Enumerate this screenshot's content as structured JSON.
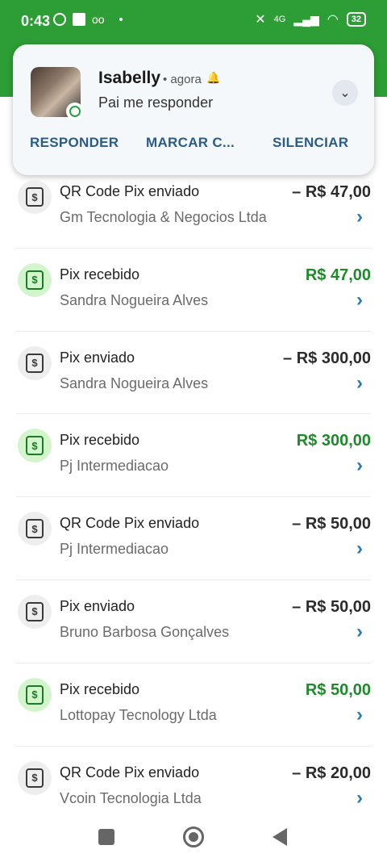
{
  "status_bar": {
    "time": "0:43",
    "network": "4G",
    "battery": "32"
  },
  "notification": {
    "sender": "Isabelly",
    "time": "• agora",
    "message": "Pai me responder",
    "actions": [
      "RESPONDER",
      "MARCAR C...",
      "SILENCIAR"
    ],
    "app_icon": "whatsapp-icon"
  },
  "transactions": [
    {
      "type": "QR Code Pix enviado",
      "name": "Gm Tecnologia & Negocios Ltda",
      "amount": "– R$ 47,00",
      "direction": "out"
    },
    {
      "type": "Pix recebido",
      "name": "Sandra Nogueira Alves",
      "amount": "R$ 47,00",
      "direction": "in"
    },
    {
      "type": "Pix enviado",
      "name": "Sandra Nogueira Alves",
      "amount": "– R$ 300,00",
      "direction": "out"
    },
    {
      "type": "Pix recebido",
      "name": "Pj Intermediacao",
      "amount": "R$ 300,00",
      "direction": "in"
    },
    {
      "type": "QR Code Pix enviado",
      "name": "Pj Intermediacao",
      "amount": "– R$ 50,00",
      "direction": "out"
    },
    {
      "type": "Pix enviado",
      "name": "Bruno Barbosa Gonçalves",
      "amount": "– R$ 50,00",
      "direction": "out"
    },
    {
      "type": "Pix recebido",
      "name": "Lottopay Tecnology Ltda",
      "amount": "R$ 50,00",
      "direction": "in"
    },
    {
      "type": "QR Code Pix enviado",
      "name": "Vcoin Tecnologia Ltda",
      "amount": "– R$ 20,00",
      "direction": "out"
    }
  ],
  "colors": {
    "header_green": "#2d9e35",
    "incoming_amount": "#1f8a2b",
    "chevron": "#2a7bb0"
  }
}
